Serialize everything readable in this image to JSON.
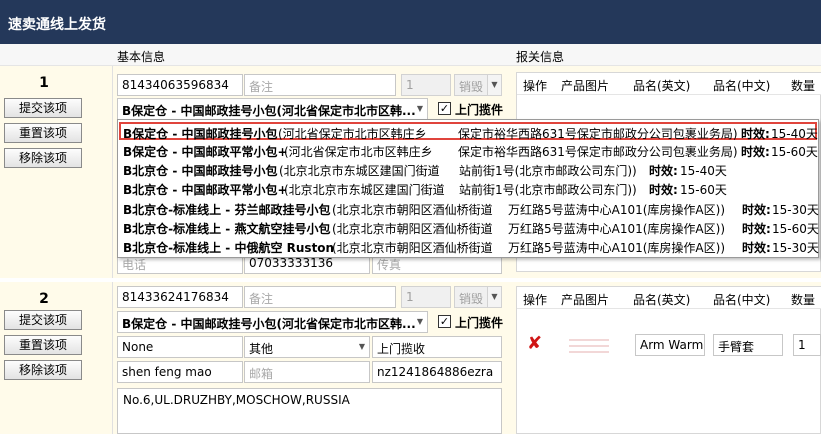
{
  "window": {
    "title": "速卖通线上发货"
  },
  "columns": {
    "basic_info": "基本信息",
    "customs_info": "报关信息"
  },
  "buttons": {
    "submit": "提交该项",
    "reset": "重置该项",
    "remove": "移除该项"
  },
  "table_headers": [
    "操作",
    "产品图片",
    "品名(英文)",
    "品名(中文)",
    "数量"
  ],
  "orders": [
    {
      "index": "1",
      "order_no": "81434063596834",
      "note_placeholder": "备注",
      "qty": "1",
      "sale_status": "销毁",
      "shipping_method": "B保定仓 - 中国邮政挂号小包(河北省保定市北市区韩...",
      "pickup_label": "上门揽件",
      "pickup_checked": true,
      "phone_placeholder": "电话",
      "phone": "07033333136",
      "fax_placeholder": "传真"
    },
    {
      "index": "2",
      "order_no": "81433624176834",
      "note_placeholder": "备注",
      "qty": "1",
      "sale_status": "销毁",
      "shipping_method": "B保定仓 - 中国邮政挂号小包(河北省保定市北市区韩...",
      "pickup_label": "上门揽件",
      "pickup_checked": true,
      "row3": {
        "insurance": "None",
        "category": "其他",
        "pickup_type": "上门揽收"
      },
      "name": "shen feng mao",
      "email_placeholder": "邮箱",
      "tracking": "nz1241864886ezra",
      "address": "No.6,UL.DRUZHBY,MOSCHOW,RUSSIA",
      "product": {
        "name_en": "Arm Warm",
        "name_cn": "手臂套",
        "qty": "1"
      }
    }
  ],
  "dropdown_options": [
    {
      "method": "B保定仓 - 中国邮政挂号小包",
      "origin": "(河北省保定市北市区韩庄乡",
      "address": "保定市裕华西路631号保定市邮政分公司包裹业务局)",
      "time_label": "时效:",
      "time": "15-40天",
      "highlighted": true
    },
    {
      "method": "B保定仓 - 中国邮政平常小包+",
      "origin": "(河北省保定市北市区韩庄乡",
      "address": "保定市裕华西路631号保定市邮政分公司包裹业务局)",
      "time_label": "时效:",
      "time": "15-60天",
      "highlighted": false
    },
    {
      "method": "B北京仓 - 中国邮政挂号小包",
      "origin": "(北京北京市东城区建国门街道",
      "address": "站前街1号(北京市邮政公司东门))",
      "time_label": "时效:",
      "time": "15-40天",
      "highlighted": false
    },
    {
      "method": "B北京仓 - 中国邮政平常小包+",
      "origin": "(北京北京市东城区建国门街道",
      "address": "站前街1号(北京市邮政公司东门))",
      "time_label": "时效:",
      "time": "15-60天",
      "highlighted": false
    },
    {
      "method": "B北京仓-标准线上 - 芬兰邮政挂号小包",
      "origin": "(北京北京市朝阳区酒仙桥街道",
      "address": "万红路5号蓝涛中心A101(库房操作A区))",
      "time_label": "时效:",
      "time": "15-30天",
      "highlighted": false
    },
    {
      "method": "B北京仓-标准线上 - 燕文航空挂号小包",
      "origin": "(北京北京市朝阳区酒仙桥街道",
      "address": "万红路5号蓝涛中心A101(库房操作A区))",
      "time_label": "时效:",
      "time": "15-60天",
      "highlighted": false
    },
    {
      "method": "B北京仓-标准线上 - 中俄航空 Ruston",
      "origin": "(北京北京市朝阳区酒仙桥街道",
      "address": "万红路5号蓝涛中心A101(库房操作A区))",
      "time_label": "时效:",
      "time": "15-30天",
      "highlighted": false
    }
  ],
  "colors": {
    "titlebar": "#24385a",
    "panel_bg": "#fffbea",
    "highlight_border": "#e0443c",
    "delete_icon": "#d01515"
  },
  "icons": {
    "delete": "red-x-icon",
    "dropdown": "triangle-down-icon",
    "checkbox": "check-icon"
  }
}
